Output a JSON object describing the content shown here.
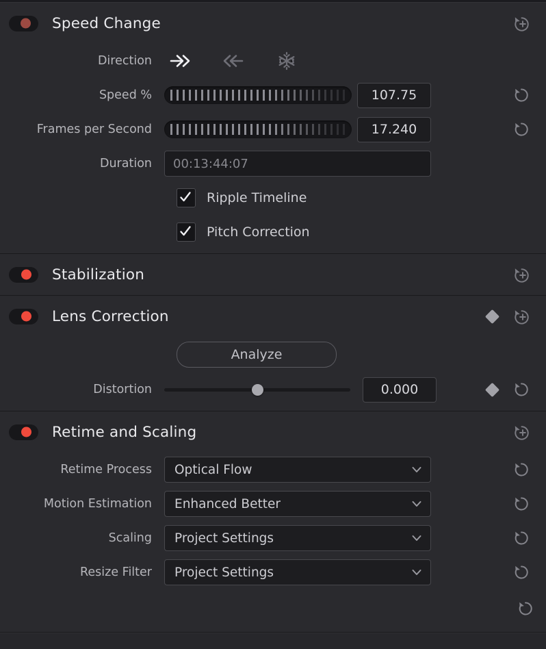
{
  "sections": [
    {
      "id": "speed-change",
      "title": "Speed Change",
      "toggle_state": "dim",
      "header_reset_icon": "reset-add-keyframe-icon",
      "direction": {
        "label": "Direction",
        "options": [
          {
            "name": "forward",
            "icon": "forward-double-arrow-icon",
            "active": true
          },
          {
            "name": "reverse",
            "icon": "reverse-double-arrow-icon",
            "active": false
          },
          {
            "name": "freeze-frame",
            "icon": "snowflake-icon",
            "active": false
          }
        ]
      },
      "speed_percent": {
        "label": "Speed %",
        "value": "107.75",
        "fill": 0.58
      },
      "frames_per_second": {
        "label": "Frames per Second",
        "value": "17.240",
        "fill": 0.58
      },
      "duration": {
        "label": "Duration",
        "value": "00:13:44:07"
      },
      "ripple_timeline": {
        "label": "Ripple Timeline",
        "checked": true
      },
      "pitch_correction": {
        "label": "Pitch Correction",
        "checked": true
      }
    },
    {
      "id": "stabilization",
      "title": "Stabilization",
      "toggle_state": "on",
      "header_reset_icon": "reset-add-keyframe-icon"
    },
    {
      "id": "lens-correction",
      "title": "Lens Correction",
      "toggle_state": "on",
      "header_keyframe_icon": "keyframe-diamond-icon",
      "header_reset_icon": "reset-add-keyframe-icon",
      "analyze_button": "Analyze",
      "distortion": {
        "label": "Distortion",
        "value": "0.000",
        "handle_pct": 50
      }
    },
    {
      "id": "retime-and-scaling",
      "title": "Retime and Scaling",
      "toggle_state": "on",
      "header_reset_icon": "reset-add-keyframe-icon",
      "fields": [
        {
          "label": "Retime Process",
          "value": "Optical Flow"
        },
        {
          "label": "Motion Estimation",
          "value": "Enhanced Better"
        },
        {
          "label": "Scaling",
          "value": "Project Settings"
        },
        {
          "label": "Resize Filter",
          "value": "Project Settings"
        }
      ]
    }
  ],
  "colors": {
    "panel_background": "#27272b",
    "section_background": "#2a2a2e",
    "toggle_on_red": "#f04a3c",
    "toggle_dim_red": "#9c4a42",
    "title_text": "#e9e9ec",
    "label_text": "#b6b6bb",
    "value_text": "#d9d9de",
    "placeholder_text": "#87878d",
    "icon_gray": "#9a9aa0"
  }
}
